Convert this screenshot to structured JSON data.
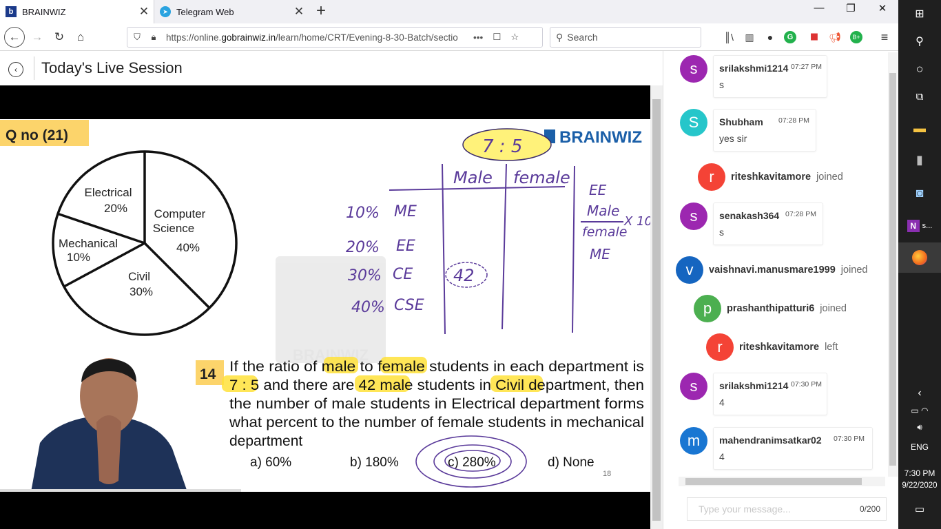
{
  "browser": {
    "tabs": [
      {
        "title": "BRAINWIZ"
      },
      {
        "title": "Telegram Web"
      }
    ],
    "url_prefix": "https://online.",
    "url_domain": "gobrainwiz.in",
    "url_path": "/learn/home/CRT/Evening-8-30-Batch/sectio",
    "url_more": "•••",
    "search_placeholder": "Search"
  },
  "page": {
    "title": "Today's Live Session"
  },
  "slide": {
    "question_badge": "Q no (21)",
    "logo_text": "BRAINWIZ",
    "watermark_text": "BRAINWIZ",
    "pie_labels": [
      {
        "name": "Electrical",
        "pct": "20%"
      },
      {
        "name": "Computer",
        "name2": "Science",
        "pct": "40%"
      },
      {
        "name": "Mechanical",
        "pct": "10%"
      },
      {
        "name": "Civil",
        "pct": "30%"
      }
    ],
    "handwriting": {
      "ratio": "7 : 5",
      "col_male": "Male",
      "col_female": "female",
      "rows": [
        {
          "pct": "10%",
          "dept": "ME"
        },
        {
          "pct": "20%",
          "dept": "EE"
        },
        {
          "pct": "30%",
          "dept": "CE"
        },
        {
          "pct": "40%",
          "dept": "CSE"
        }
      ],
      "circled": "42",
      "side_top": "EE",
      "side_num": "Male",
      "side_den": "female",
      "side_mul": "X 10",
      "side_bottom": "ME"
    },
    "question_number": "14",
    "question_lines": [
      "If the ratio of male to female students in each department is",
      "7 : 5 and there are 42 male students in Civil department, then",
      "the number of male students in Electrical department forms",
      "what percent to the number of female students in mechanical",
      "department"
    ],
    "options": [
      "a) 60%",
      "b) 180%",
      "c) 280%",
      "d) None"
    ],
    "page_number": "18"
  },
  "chat": {
    "messages": [
      {
        "initial": "s",
        "color": "#9c27b0",
        "name": "srilakshmi1214",
        "time": "07:27 PM",
        "text": "s"
      },
      {
        "initial": "S",
        "color": "#26c6ca",
        "name": "Shubham",
        "time": "07:28 PM",
        "text": "yes sir"
      },
      {
        "initial": "s",
        "color": "#9c27b0",
        "name": "senakash364",
        "time": "07:28 PM",
        "text": "s"
      },
      {
        "initial": "s",
        "color": "#9c27b0",
        "name": "srilakshmi1214",
        "time": "07:30 PM",
        "text": "4"
      },
      {
        "initial": "m",
        "color": "#1976d2",
        "name": "mahendranimsatkar02",
        "time": "07:30 PM",
        "text": "4"
      }
    ],
    "events": [
      {
        "initial": "r",
        "color": "#f44336",
        "name": "riteshkavitamore",
        "action": "joined"
      },
      {
        "initial": "v",
        "color": "#1565c0",
        "name": "vaishnavi.manusmare1999",
        "action": "joined"
      },
      {
        "initial": "p",
        "color": "#4caf50",
        "name": "prashanthipatturi6",
        "action": "joined"
      },
      {
        "initial": "r",
        "color": "#f44336",
        "name": "riteshkavitamore",
        "action": "left"
      }
    ],
    "input_placeholder": "Type your message...",
    "char_count": "0/200"
  },
  "taskbar": {
    "onenote_label": "s...",
    "language": "ENG",
    "time": "7:30 PM",
    "date": "9/22/2020"
  }
}
